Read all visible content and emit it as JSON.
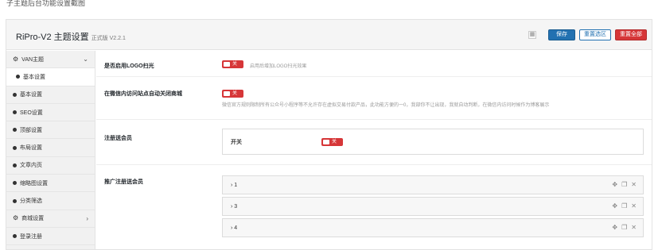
{
  "caption": "子主题后台功能设置截图",
  "header": {
    "title": "RiPro-V2 主题设置",
    "version": "正式版 V2.2.1",
    "grid_icon": "▦",
    "save_label": "保存",
    "reset_section_label": "重置选区",
    "reset_all_label": "重置全部"
  },
  "sidebar": {
    "items": [
      {
        "label": "VAN主题",
        "icon": "gear",
        "chevron": "⌄",
        "type": "parent"
      },
      {
        "label": "基本设置",
        "icon": "dot",
        "type": "sub"
      },
      {
        "label": "基本设置",
        "icon": "dot",
        "type": "parent"
      },
      {
        "label": "SEO设置",
        "icon": "dot",
        "type": "parent"
      },
      {
        "label": "顶部设置",
        "icon": "dot",
        "type": "parent"
      },
      {
        "label": "布局设置",
        "icon": "dot",
        "type": "parent"
      },
      {
        "label": "文章内页",
        "icon": "dot",
        "type": "parent"
      },
      {
        "label": "缩略图设置",
        "icon": "dot",
        "type": "parent"
      },
      {
        "label": "分类筛选",
        "icon": "dot",
        "type": "parent"
      },
      {
        "label": "商城设置",
        "icon": "gear",
        "chevron": "›",
        "type": "parent"
      },
      {
        "label": "登录注册",
        "icon": "dot",
        "type": "parent"
      }
    ]
  },
  "main": {
    "logo_glow": {
      "label": "是否启用LOGO扫光",
      "toggle": "关",
      "desc": "启用后增加LOGO扫光效果"
    },
    "wechat_close": {
      "label": "在微信内访问站点自动关闭商城",
      "toggle": "关",
      "desc": "微信官方规则限制所有公众号小程序等不允许存在虚拟交易付款产品，此功能方便的一0，我部你不让出现，我就自动判断，在微信内访问时候作为博客展示"
    },
    "register_gift": {
      "label": "注册送会员",
      "switch_label": "开关",
      "toggle": "关"
    },
    "promo_gift": {
      "label": "推广注册送会员",
      "items": [
        "1",
        "3",
        "4"
      ],
      "item_prefix": "›"
    },
    "controls": {
      "move": "✥",
      "copy": "❐",
      "remove": "✕"
    }
  }
}
